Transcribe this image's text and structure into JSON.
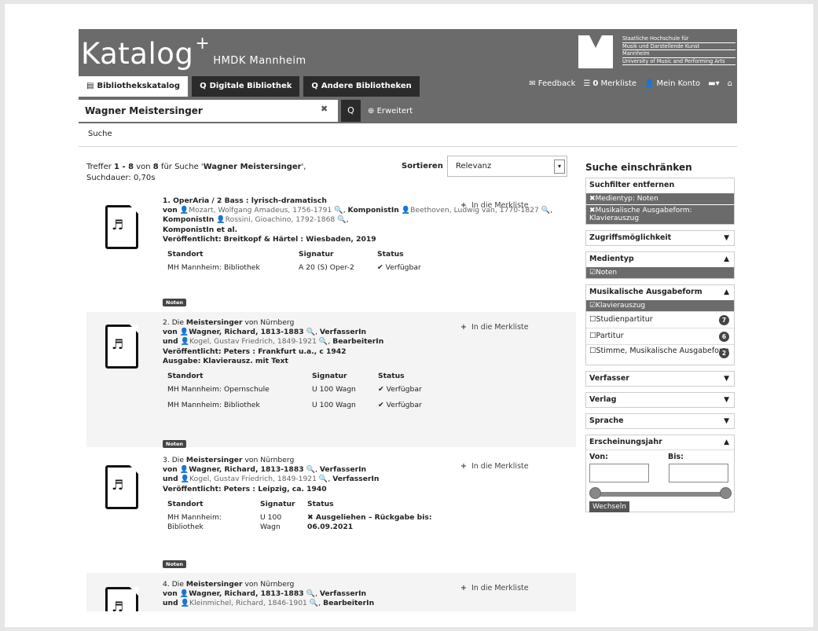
{
  "header": {
    "logo_text": "Katalog",
    "logo_sup": "+",
    "logo_sub": "HMDK Mannheim",
    "institution_lines": [
      "Staatliche Hochschule für",
      "Musik und Darstellende Kunst",
      "Mannheim",
      "University of Music and Performing Arts"
    ],
    "tabs": [
      {
        "icon": "▤",
        "label": "Bibliothekskatalog"
      },
      {
        "icon": "Q",
        "label": "Digitale Bibliothek"
      },
      {
        "icon": "Q",
        "label": "Andere Bibliotheken"
      }
    ],
    "feedback": "Feedback",
    "merkliste_count": "0",
    "merkliste": "Merkliste",
    "account": "Mein Konto"
  },
  "search": {
    "query": "Wagner Meistersinger",
    "clear": "✖",
    "submit": "Q",
    "advanced": "Erweitert"
  },
  "breadcrumb": "Suche",
  "summary": {
    "prefix": "Treffer ",
    "range": "1 - 8",
    "of": " von ",
    "total": "8",
    "for": " für Suche '",
    "query": "Wagner Meistersinger",
    "suffix": "',",
    "duration_label": "Suchdauer: ",
    "duration": "0,70s"
  },
  "sort": {
    "label": "Sortieren",
    "value": "Relevanz"
  },
  "merk_label": "In die Merkliste",
  "table_headers": {
    "location": "Standort",
    "signature": "Signatur",
    "status": "Status"
  },
  "results": [
    {
      "num": "1.",
      "title_pre": " OperAria / 2 Bass : lyrisch-dramatisch",
      "authors1_prefix": "von",
      "authors1": "Mozart, Wolfgang Amadeus, 1756-1791",
      "role_a": "KomponistIn",
      "author2": "Beethoven, Ludwig van, 1770-1827",
      "role_b": "KomponistIn",
      "author3": "Rossini, Gioachino, 1792-1868",
      "role_c": "KomponistIn et al.",
      "published_label": "Veröffentlicht:",
      "published": "Breitkopf & Härtel : Wiesbaden, 2019",
      "holdings": [
        {
          "location": "MH Mannheim: Bibliothek",
          "signature": "A 20 (S) Oper-2",
          "status": "Verfügbar"
        }
      ],
      "badge": "Noten"
    },
    {
      "num": "2.",
      "title_a": " Die ",
      "title_hl": "Meistersinger",
      "title_b": " von Nürnberg",
      "by1_prefix": "von",
      "by1": "Wagner, Richard, 1813-1883",
      "by1_role": "VerfasserIn",
      "by2_prefix": "und",
      "by2": "Kogel, Gustav Friedrich, 1849-1921",
      "by2_role": "BearbeiterIn",
      "published_label": "Veröffentlicht:",
      "published": "Peters : Frankfurt u.a., c 1942",
      "edition_label": "Ausgabe:",
      "edition": "Klavierausz. mit Text",
      "holdings": [
        {
          "location": "MH Mannheim: Opernschule",
          "signature": "U 100 Wagn",
          "status": "Verfügbar"
        },
        {
          "location": "MH Mannheim: Bibliothek",
          "signature": "U 100 Wagn",
          "status": "Verfügbar"
        }
      ],
      "badge": "Noten"
    },
    {
      "num": "3.",
      "title_a": " Die ",
      "title_hl": "Meistersinger",
      "title_b": " von Nürnberg",
      "by1_prefix": "von",
      "by1": "Wagner, Richard, 1813-1883",
      "by1_role": "VerfasserIn",
      "by2_prefix": "und",
      "by2": "Kogel, Gustav Friedrich, 1849-1921",
      "by2_role": "VerfasserIn",
      "published_label": "Veröffentlicht:",
      "published": "Peters : Leipzig, ca. 1940",
      "holding": {
        "location_l1": "MH Mannheim:",
        "location_l2": "Bibliothek",
        "signature_l1": "U 100",
        "signature_l2": "Wagn",
        "status_l1": "Ausgeliehen – Rückgabe bis:",
        "status_l2": "06.09.2021"
      },
      "badge": "Noten"
    },
    {
      "num": "4.",
      "title_a": " Die ",
      "title_hl": "Meistersinger",
      "title_b": " von Nürnberg",
      "by1_prefix": "von",
      "by1": "Wagner, Richard, 1813-1883",
      "by1_role": "VerfasserIn",
      "by2_prefix": "und",
      "by2": "Kleinmichel, Richard, 1846-1901",
      "by2_role": "BearbeiterIn"
    }
  ],
  "sidebar": {
    "title": "Suche einschränken",
    "remove_filters": "Suchfilter entfernen",
    "active_filters": [
      "Medientyp: Noten",
      "Musikalische Ausgabeform: Klavierauszug"
    ],
    "access": "Zugriffsmöglichkeit",
    "mediatype": "Medientyp",
    "mediatype_selected": "Noten",
    "form": "Musikalische Ausgabeform",
    "form_selected": "Klavierauszug",
    "form_items": [
      {
        "label": "Studienpartitur",
        "count": "7"
      },
      {
        "label": "Partitur",
        "count": "6"
      },
      {
        "label": "Stimme, Musikalische Ausgabeform",
        "count": "2"
      }
    ],
    "author": "Verfasser",
    "publisher": "Verlag",
    "language": "Sprache",
    "year": "Erscheinungsjahr",
    "from": "Von:",
    "to": "Bis:",
    "switch": "Wechseln"
  }
}
